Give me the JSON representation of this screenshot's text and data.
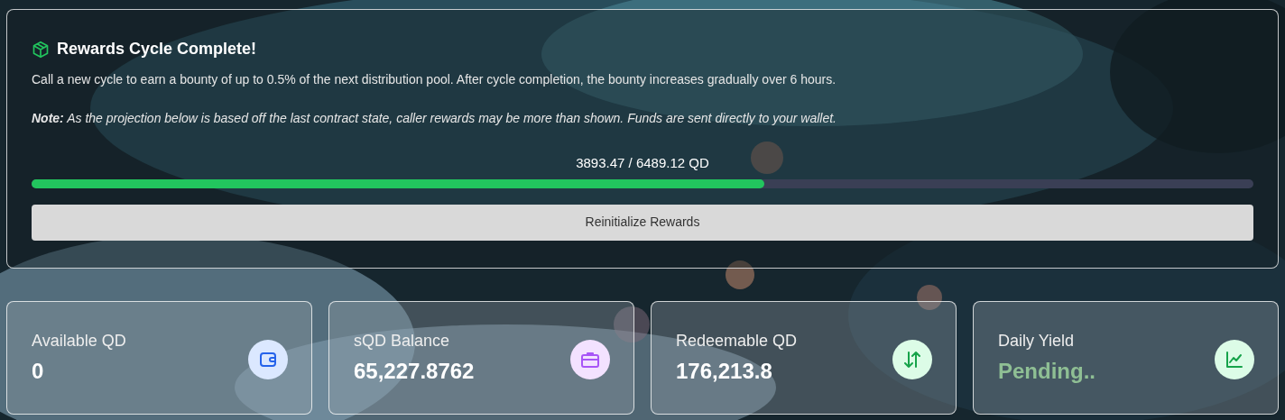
{
  "rewards_panel": {
    "title": "Rewards Cycle Complete!",
    "description": "Call a new cycle to earn a bounty of up to 0.5% of the next distribution pool. After cycle completion, the bounty increases gradually over 6 hours.",
    "note": "**Note:** As the projection below is based off the last contract state, caller rewards may be more than shown. Funds are sent directly to your wallet.",
    "progress_label": "3893.47 / 6489.12 QD",
    "level": 0.6,
    "button": "Reinitialize Rewards"
  },
  "stats": [
    {
      "label": "Available QD",
      "value": "0",
      "kind": "amount"
    },
    {
      "label": "sQD Balance",
      "value": "65,227.8762",
      "kind": "amount"
    },
    {
      "label": "Redeemable QD",
      "value": "176,213.8",
      "kind": "amount"
    },
    {
      "label": "Daily Yield",
      "value": "Pending..",
      "kind": "pending"
    }
  ]
}
